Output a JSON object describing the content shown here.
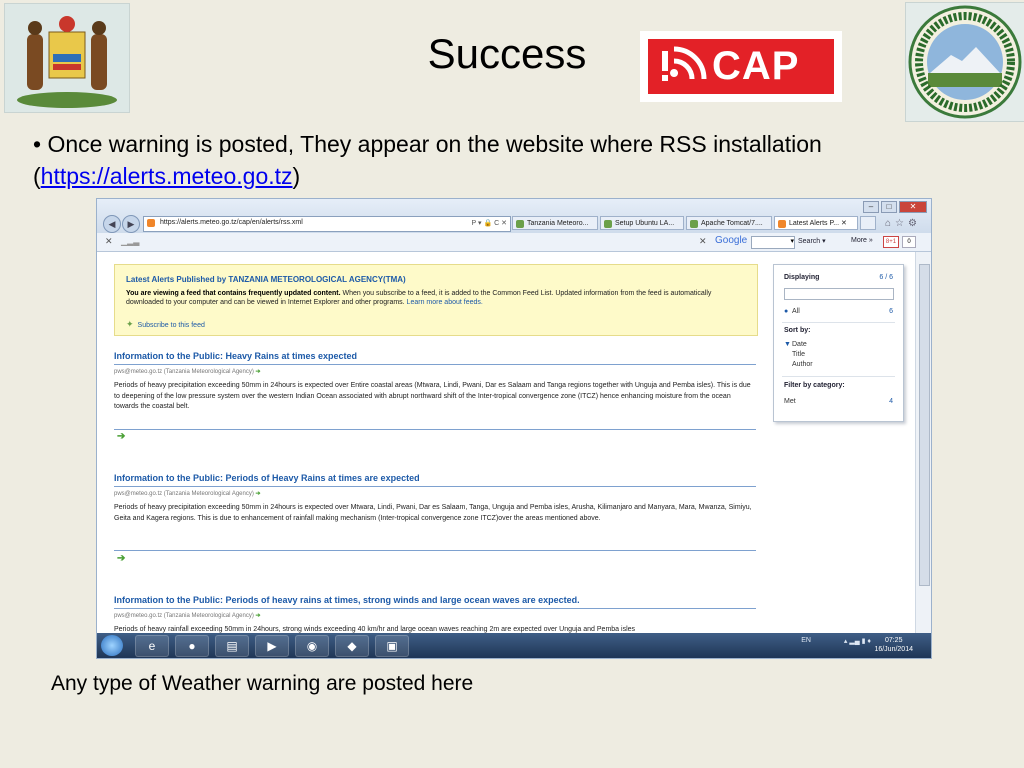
{
  "slide": {
    "title": "Success",
    "bullet_prefix": "• Once warning is posted, They appear on the website where RSS  installation (",
    "bullet_link": "https://alerts.meteo.go.tz",
    "bullet_suffix": ")",
    "caption": "Any type of Weather warning are posted here",
    "cap_logo_text": "CAP"
  },
  "browser": {
    "address": "https://alerts.meteo.go.tz/cap/en/alerts/rss.xml",
    "address_controls": "P ▾ 🔒 C ✕",
    "tabs": [
      "Tanzania Meteoro...",
      "Setup Ubuntu LA...",
      "Apache Tomcat/7....",
      "Latest Alerts P... ✕"
    ],
    "google_label": "Google",
    "search_label": "Search ▾",
    "more_label": "More »",
    "plus_label": "8+1",
    "num_label": "0"
  },
  "feed": {
    "banner_title": "Latest Alerts Published by TANZANIA METEOROLOGICAL AGENCY(TMA)",
    "banner_bold": "You are viewing a feed that contains frequently updated content.",
    "banner_text": " When you subscribe to a feed, it is added to the Common Feed List. Updated information from the feed is automatically downloaded to your computer and can be viewed in Internet Explorer and other programs.",
    "banner_link": " Learn more about feeds.",
    "subscribe": "Subscribe to this feed",
    "entries": [
      {
        "title": "Information to the Public: Heavy Rains at times expected",
        "meta": "pws@meteo.go.tz (Tanzania Meteorological Agency)",
        "body": "Periods of heavy precipitation exceeding 50mm in 24hours is expected over Entire coastal areas (Mtwara, Lindi, Pwani, Dar es Salaam and Tanga regions together with Unguja and Pemba isles). This is due to deepening of the low pressure system over the western Indian Ocean associated with abrupt northward shift of the Inter-tropical convergence zone (ITCZ) hence enhancing moisture from the ocean towards the coastal belt."
      },
      {
        "title": "Information to the Public: Periods of Heavy Rains at times are expected",
        "meta": "pws@meteo.go.tz (Tanzania Meteorological Agency)",
        "body": "Periods of heavy precipitation exceeding 50mm in 24hours is expected over Mtwara, Lindi, Pwani, Dar es Salaam, Tanga, Unguja and Pemba isles, Arusha, Kilimanjaro and Manyara, Mara, Mwanza, Simiyu, Geita and Kagera regions. This is due to enhancement of rainfall making mechanism (Inter-tropical convergence zone ITCZ)over the areas mentioned above."
      },
      {
        "title": "Information to the Public: Periods of heavy rains at times, strong winds and large ocean waves are expected.",
        "meta": "pws@meteo.go.tz (Tanzania Meteorological Agency)",
        "body": "Periods of heavy rainfall exceeding 50mm in 24hours, strong winds exceeding 40 km/hr and large ocean waves reaching 2m are expected over Unguja and Pemba isles"
      }
    ]
  },
  "sidebar": {
    "displaying": "Displaying",
    "displaying_count": "6 / 6",
    "all": "All",
    "all_count": "6",
    "sort_by": "Sort by:",
    "sort_date": "Date",
    "sort_title": "Title",
    "sort_author": "Author",
    "filter_by": "Filter by category:",
    "category": "Met",
    "category_count": "4"
  },
  "taskbar": {
    "lang": "EN",
    "time": "07:25",
    "date": "16/Jun/2014"
  }
}
